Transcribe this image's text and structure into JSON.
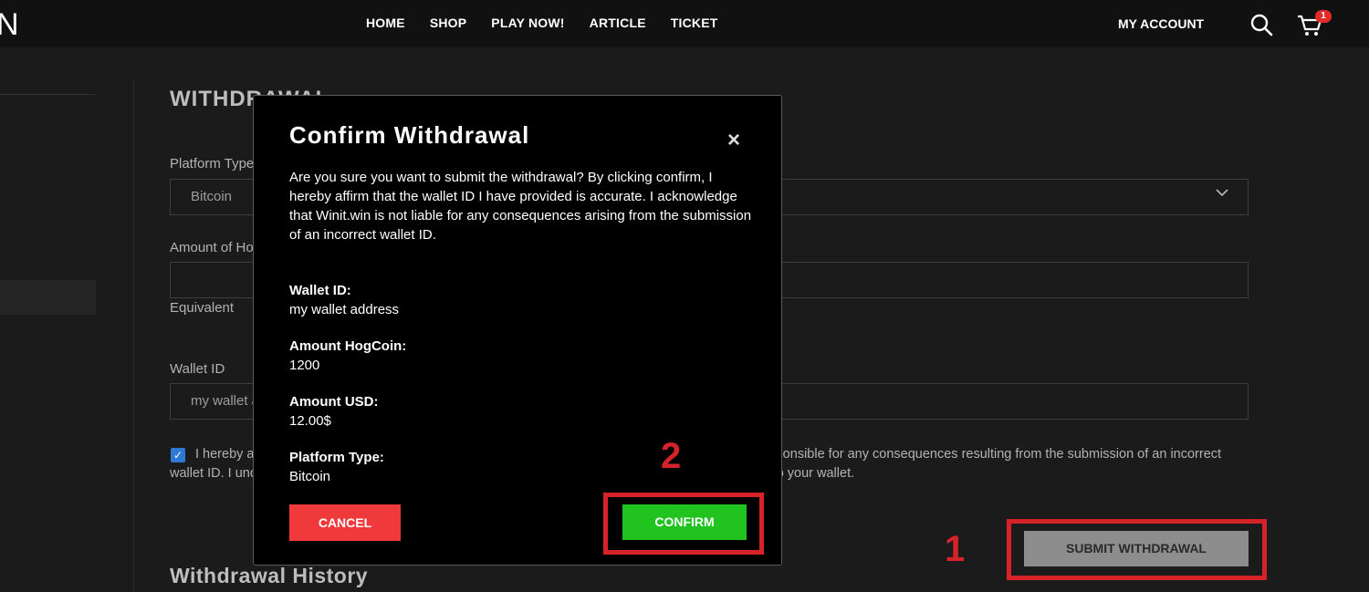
{
  "header": {
    "logo_fragment": "N",
    "nav": [
      "HOME",
      "SHOP",
      "PLAY NOW!",
      "ARTICLE",
      "TICKET"
    ],
    "account_label": "MY ACCOUNT",
    "cart_count": "1"
  },
  "form": {
    "section_title": "WITHDRAWAL",
    "platform_label": "Platform Type",
    "platform_value": "Bitcoin",
    "amount_label": "Amount of HogCoin",
    "amount_value": "",
    "equivalent_label": "Equivalent",
    "wallet_label": "Wallet ID",
    "wallet_value": "my wallet address",
    "terms_checked": true,
    "terms_text": "I hereby affirm that the wallet ID I have provided is accurate. I acknowledge that Winit.win is not responsible for any consequences resulting from the submission of an incorrect wallet ID. I understand that fees may apply, and these fees will be deducted from the total amount sent to your wallet.",
    "submit_label": "SUBMIT WITHDRAWAL",
    "history_title": "Withdrawal History"
  },
  "modal": {
    "title": "Confirm Withdrawal",
    "close_icon": "×",
    "message": "Are you sure you want to submit the withdrawal? By clicking confirm, I hereby affirm that the wallet ID I have provided is accurate. I acknowledge that Winit.win is not liable for any consequences arising from the submission of an incorrect wallet ID.",
    "wallet_label": "Wallet ID:",
    "wallet_value": "my wallet address",
    "hogcoin_label": "Amount HogCoin:",
    "hogcoin_value": "1200",
    "usd_label": "Amount USD:",
    "usd_value": "12.00$",
    "platform_label": "Platform Type:",
    "platform_value": "Bitcoin",
    "cancel_label": "CANCEL",
    "confirm_label": "CONFIRM"
  },
  "annotations": {
    "step1": "1",
    "step2": "2",
    "color": "#d6232a"
  },
  "colors": {
    "confirm": "#21c41f",
    "cancel": "#f0393b",
    "checkbox": "#2f79d6"
  }
}
